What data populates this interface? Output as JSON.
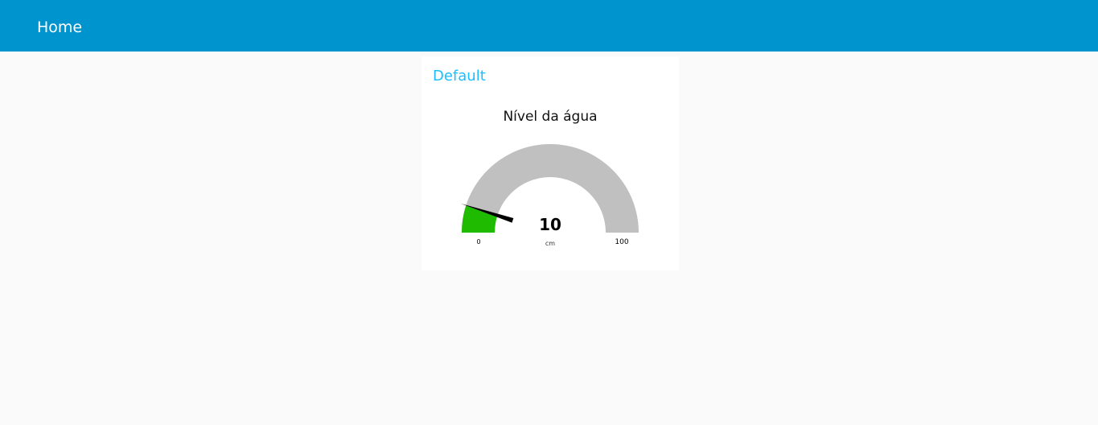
{
  "toolbar": {
    "title": "Home",
    "background_color": "#0094ce"
  },
  "group": {
    "title": "Default",
    "title_color": "#1bbfff"
  },
  "gauge": {
    "title": "Nível da água",
    "value": 10,
    "value_label": "10",
    "units": "cm",
    "min": 0,
    "max": 100,
    "min_label": "0",
    "max_label": "100",
    "fill_color": "#1fbb00",
    "track_color": "#c0c0c0",
    "needle_color": "#000000"
  }
}
